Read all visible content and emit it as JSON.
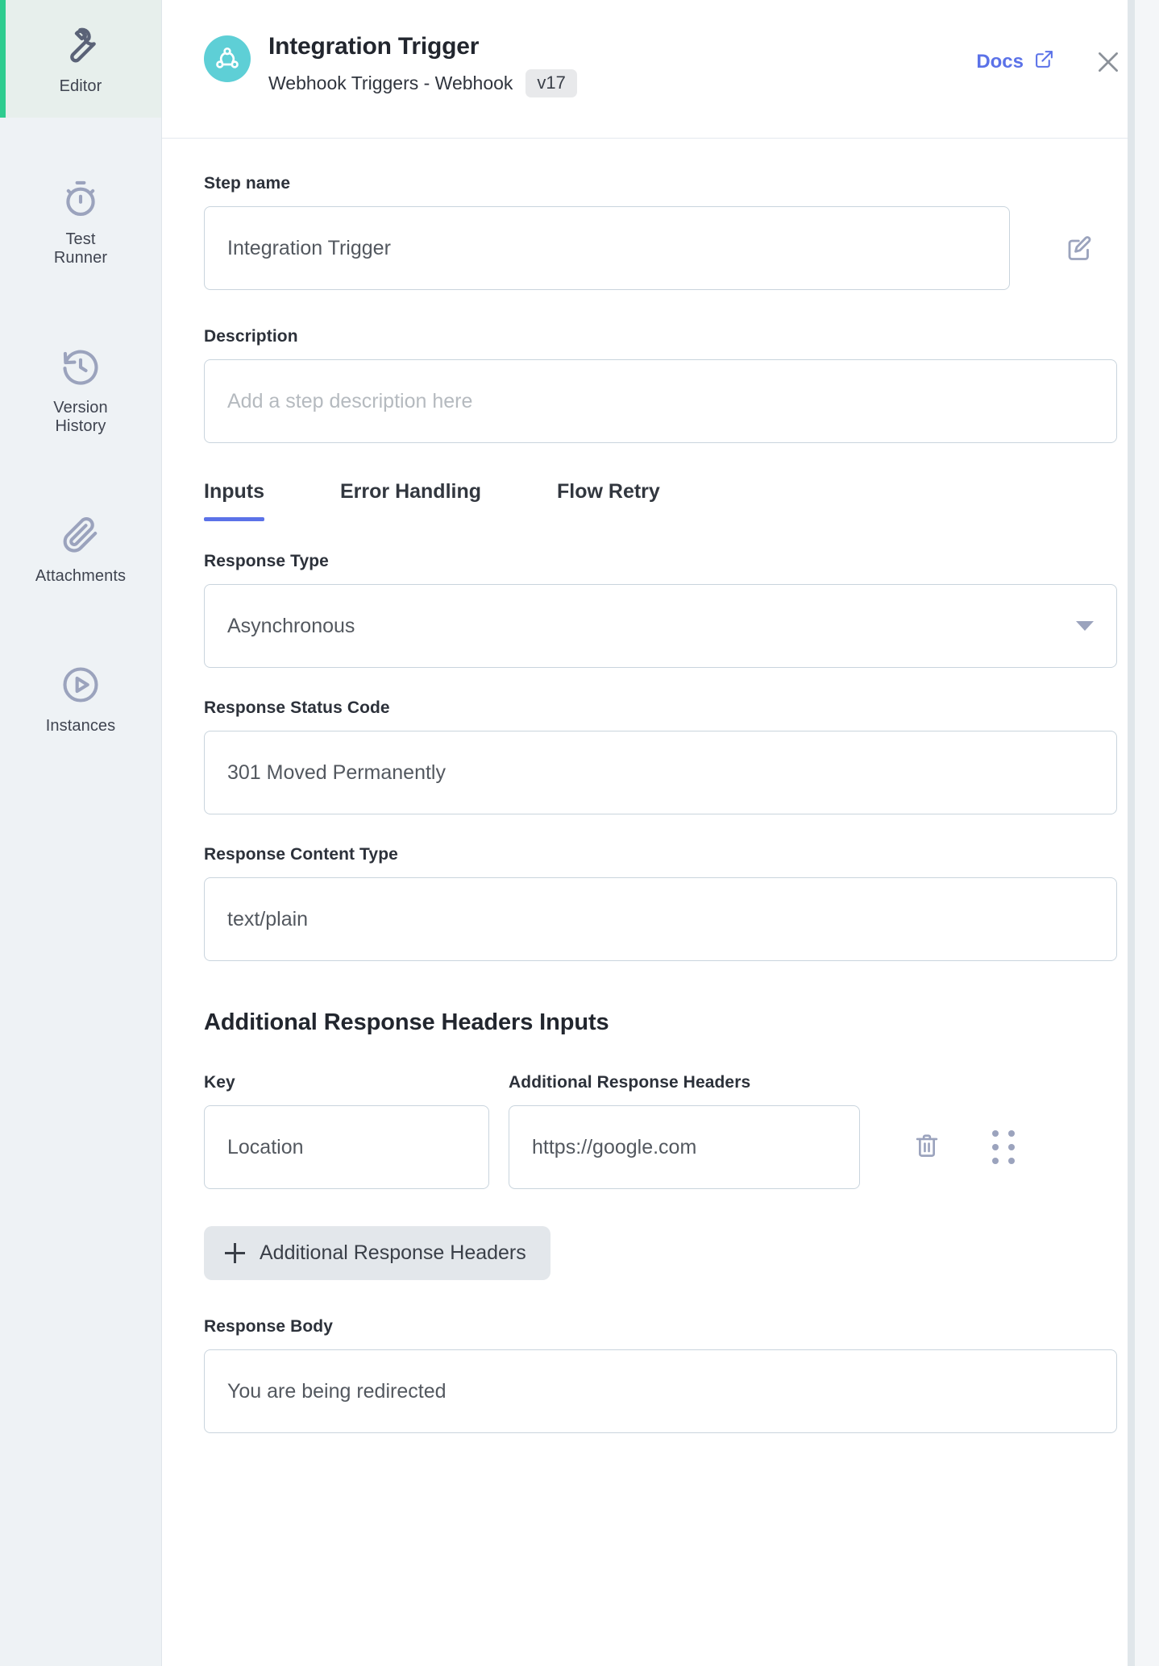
{
  "sidebar": {
    "items": [
      {
        "label": "Editor",
        "icon": "wrench-icon",
        "active": true
      },
      {
        "label": "Test\nRunner",
        "icon": "stopwatch-icon",
        "active": false
      },
      {
        "label": "Version\nHistory",
        "icon": "history-clock-icon",
        "active": false
      },
      {
        "label": "Attachments",
        "icon": "paperclip-icon",
        "active": false
      },
      {
        "label": "Instances",
        "icon": "play-circle-icon",
        "active": false
      }
    ],
    "active_accent_color": "#2ecc8f"
  },
  "header": {
    "icon": "webhook-icon",
    "icon_bg_color": "#5ecfd6",
    "title": "Integration Trigger",
    "subtitle": "Webhook Triggers - Webhook",
    "version": "v17",
    "docs_label": "Docs",
    "docs_icon": "external-link-icon",
    "docs_color": "#5b72e8",
    "close_icon": "close-icon"
  },
  "form": {
    "step_name": {
      "label": "Step name",
      "value": "Integration Trigger",
      "edit_icon": "edit-pencil-icon"
    },
    "description": {
      "label": "Description",
      "value": "",
      "placeholder": "Add a step description here"
    }
  },
  "tabs": {
    "items": [
      {
        "label": "Inputs",
        "active": true
      },
      {
        "label": "Error Handling",
        "active": false
      },
      {
        "label": "Flow Retry",
        "active": false
      }
    ],
    "active_underline_color": "#5b72e8"
  },
  "inputs": {
    "response_type": {
      "label": "Response Type",
      "value": "Asynchronous",
      "caret_icon": "chevron-down-icon"
    },
    "response_status_code": {
      "label": "Response Status Code",
      "value": "301 Moved Permanently"
    },
    "response_content_type": {
      "label": "Response Content Type",
      "value": "text/plain"
    },
    "additional_headers": {
      "section_title": "Additional Response Headers Inputs",
      "col_key_label": "Key",
      "col_value_label": "Additional Response Headers",
      "rows": [
        {
          "key": "Location",
          "value": "https://google.com",
          "delete_icon": "trash-icon",
          "drag_icon": "drag-handle-icon"
        }
      ],
      "add_button_label": "Additional Response Headers",
      "add_button_icon": "plus-icon"
    },
    "response_body": {
      "label": "Response Body",
      "value": "You are being redirected"
    }
  }
}
